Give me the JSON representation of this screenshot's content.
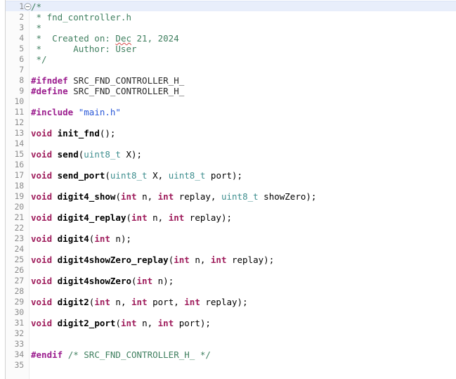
{
  "editor": {
    "name": "source-code-editor",
    "language": "C header",
    "total_lines": 35,
    "current_line": 1,
    "colors": {
      "background": "#ffffff",
      "gutter_background": "#fbfbfb",
      "line_number": "#8c8c8c",
      "current_line_highlight": "#e8eefb",
      "comment": "#3f7f5f",
      "preprocessor": "#9b1d8e",
      "string": "#2a58d8",
      "keyword": "#9f1d5c",
      "type": "#3f8f8f",
      "function_name": "#000000",
      "spellcheck_underline": "#d64545"
    }
  },
  "lines": [
    {
      "number": "1",
      "fold": "collapse-marker",
      "tokens": [
        {
          "text": "/*",
          "type": "comment"
        }
      ]
    },
    {
      "number": "2",
      "tokens": [
        {
          "text": " * fnd_controller.h",
          "type": "comment"
        }
      ]
    },
    {
      "number": "3",
      "tokens": [
        {
          "text": " *",
          "type": "comment"
        }
      ]
    },
    {
      "number": "4",
      "tokens": [
        {
          "text": " *  Created on: ",
          "type": "comment"
        },
        {
          "text": "Dec",
          "type": "comment",
          "spellcheck": true
        },
        {
          "text": " 21, 2024",
          "type": "comment"
        }
      ]
    },
    {
      "number": "5",
      "tokens": [
        {
          "text": " *      Author: User",
          "type": "comment"
        }
      ]
    },
    {
      "number": "6",
      "tokens": [
        {
          "text": " */",
          "type": "comment"
        }
      ]
    },
    {
      "number": "7",
      "tokens": []
    },
    {
      "number": "8",
      "tokens": [
        {
          "text": "#ifndef",
          "type": "pp"
        },
        {
          "text": " ",
          "type": "plain"
        },
        {
          "text": "SRC_FND_CONTROLLER_H_",
          "type": "macro"
        }
      ]
    },
    {
      "number": "9",
      "tokens": [
        {
          "text": "#define",
          "type": "pp"
        },
        {
          "text": " ",
          "type": "plain"
        },
        {
          "text": "SRC_FND_CONTROLLER_H_",
          "type": "macro"
        }
      ]
    },
    {
      "number": "10",
      "tokens": []
    },
    {
      "number": "11",
      "tokens": [
        {
          "text": "#include",
          "type": "pp"
        },
        {
          "text": " ",
          "type": "plain"
        },
        {
          "text": "\"main.h\"",
          "type": "string"
        }
      ]
    },
    {
      "number": "12",
      "tokens": []
    },
    {
      "number": "13",
      "tokens": [
        {
          "text": "void",
          "type": "kw"
        },
        {
          "text": " ",
          "type": "plain"
        },
        {
          "text": "init_fnd",
          "type": "fn"
        },
        {
          "text": "();",
          "type": "punct"
        }
      ]
    },
    {
      "number": "14",
      "tokens": []
    },
    {
      "number": "15",
      "tokens": [
        {
          "text": "void",
          "type": "kw"
        },
        {
          "text": " ",
          "type": "plain"
        },
        {
          "text": "send",
          "type": "fn"
        },
        {
          "text": "(",
          "type": "punct"
        },
        {
          "text": "uint8_t",
          "type": "type"
        },
        {
          "text": " X",
          "type": "plain"
        },
        {
          "text": ");",
          "type": "punct"
        }
      ]
    },
    {
      "number": "16",
      "tokens": []
    },
    {
      "number": "17",
      "tokens": [
        {
          "text": "void",
          "type": "kw"
        },
        {
          "text": " ",
          "type": "plain"
        },
        {
          "text": "send_port",
          "type": "fn"
        },
        {
          "text": "(",
          "type": "punct"
        },
        {
          "text": "uint8_t",
          "type": "type"
        },
        {
          "text": " X, ",
          "type": "plain"
        },
        {
          "text": "uint8_t",
          "type": "type"
        },
        {
          "text": " port",
          "type": "plain"
        },
        {
          "text": ");",
          "type": "punct"
        }
      ]
    },
    {
      "number": "18",
      "tokens": []
    },
    {
      "number": "19",
      "tokens": [
        {
          "text": "void",
          "type": "kw"
        },
        {
          "text": " ",
          "type": "plain"
        },
        {
          "text": "digit4_show",
          "type": "fn"
        },
        {
          "text": "(",
          "type": "punct"
        },
        {
          "text": "int",
          "type": "kw"
        },
        {
          "text": " n, ",
          "type": "plain"
        },
        {
          "text": "int",
          "type": "kw"
        },
        {
          "text": " replay, ",
          "type": "plain"
        },
        {
          "text": "uint8_t",
          "type": "type"
        },
        {
          "text": " showZero",
          "type": "plain"
        },
        {
          "text": ");",
          "type": "punct"
        }
      ]
    },
    {
      "number": "20",
      "tokens": []
    },
    {
      "number": "21",
      "tokens": [
        {
          "text": "void",
          "type": "kw"
        },
        {
          "text": " ",
          "type": "plain"
        },
        {
          "text": "digit4_replay",
          "type": "fn"
        },
        {
          "text": "(",
          "type": "punct"
        },
        {
          "text": "int",
          "type": "kw"
        },
        {
          "text": " n, ",
          "type": "plain"
        },
        {
          "text": "int",
          "type": "kw"
        },
        {
          "text": " replay",
          "type": "plain"
        },
        {
          "text": ");",
          "type": "punct"
        }
      ]
    },
    {
      "number": "22",
      "tokens": []
    },
    {
      "number": "23",
      "tokens": [
        {
          "text": "void",
          "type": "kw"
        },
        {
          "text": " ",
          "type": "plain"
        },
        {
          "text": "digit4",
          "type": "fn"
        },
        {
          "text": "(",
          "type": "punct"
        },
        {
          "text": "int",
          "type": "kw"
        },
        {
          "text": " n",
          "type": "plain"
        },
        {
          "text": ");",
          "type": "punct"
        }
      ]
    },
    {
      "number": "24",
      "tokens": []
    },
    {
      "number": "25",
      "tokens": [
        {
          "text": "void",
          "type": "kw"
        },
        {
          "text": " ",
          "type": "plain"
        },
        {
          "text": "digit4showZero_replay",
          "type": "fn"
        },
        {
          "text": "(",
          "type": "punct"
        },
        {
          "text": "int",
          "type": "kw"
        },
        {
          "text": " n, ",
          "type": "plain"
        },
        {
          "text": "int",
          "type": "kw"
        },
        {
          "text": " replay",
          "type": "plain"
        },
        {
          "text": ");",
          "type": "punct"
        }
      ]
    },
    {
      "number": "26",
      "tokens": []
    },
    {
      "number": "27",
      "tokens": [
        {
          "text": "void",
          "type": "kw"
        },
        {
          "text": " ",
          "type": "plain"
        },
        {
          "text": "digit4showZero",
          "type": "fn"
        },
        {
          "text": "(",
          "type": "punct"
        },
        {
          "text": "int",
          "type": "kw"
        },
        {
          "text": " n",
          "type": "plain"
        },
        {
          "text": ");",
          "type": "punct"
        }
      ]
    },
    {
      "number": "28",
      "tokens": []
    },
    {
      "number": "29",
      "tokens": [
        {
          "text": "void",
          "type": "kw"
        },
        {
          "text": " ",
          "type": "plain"
        },
        {
          "text": "digit2",
          "type": "fn"
        },
        {
          "text": "(",
          "type": "punct"
        },
        {
          "text": "int",
          "type": "kw"
        },
        {
          "text": " n, ",
          "type": "plain"
        },
        {
          "text": "int",
          "type": "kw"
        },
        {
          "text": " port, ",
          "type": "plain"
        },
        {
          "text": "int",
          "type": "kw"
        },
        {
          "text": " replay",
          "type": "plain"
        },
        {
          "text": ");",
          "type": "punct"
        }
      ]
    },
    {
      "number": "30",
      "tokens": []
    },
    {
      "number": "31",
      "tokens": [
        {
          "text": "void",
          "type": "kw"
        },
        {
          "text": " ",
          "type": "plain"
        },
        {
          "text": "digit2_port",
          "type": "fn"
        },
        {
          "text": "(",
          "type": "punct"
        },
        {
          "text": "int",
          "type": "kw"
        },
        {
          "text": " n, ",
          "type": "plain"
        },
        {
          "text": "int",
          "type": "kw"
        },
        {
          "text": " port",
          "type": "plain"
        },
        {
          "text": ");",
          "type": "punct"
        }
      ]
    },
    {
      "number": "32",
      "tokens": []
    },
    {
      "number": "33",
      "tokens": []
    },
    {
      "number": "34",
      "tokens": [
        {
          "text": "#endif",
          "type": "pp"
        },
        {
          "text": " ",
          "type": "plain"
        },
        {
          "text": "/* SRC_FND_CONTROLLER_H_ */",
          "type": "comment"
        }
      ]
    },
    {
      "number": "35",
      "tokens": []
    }
  ]
}
